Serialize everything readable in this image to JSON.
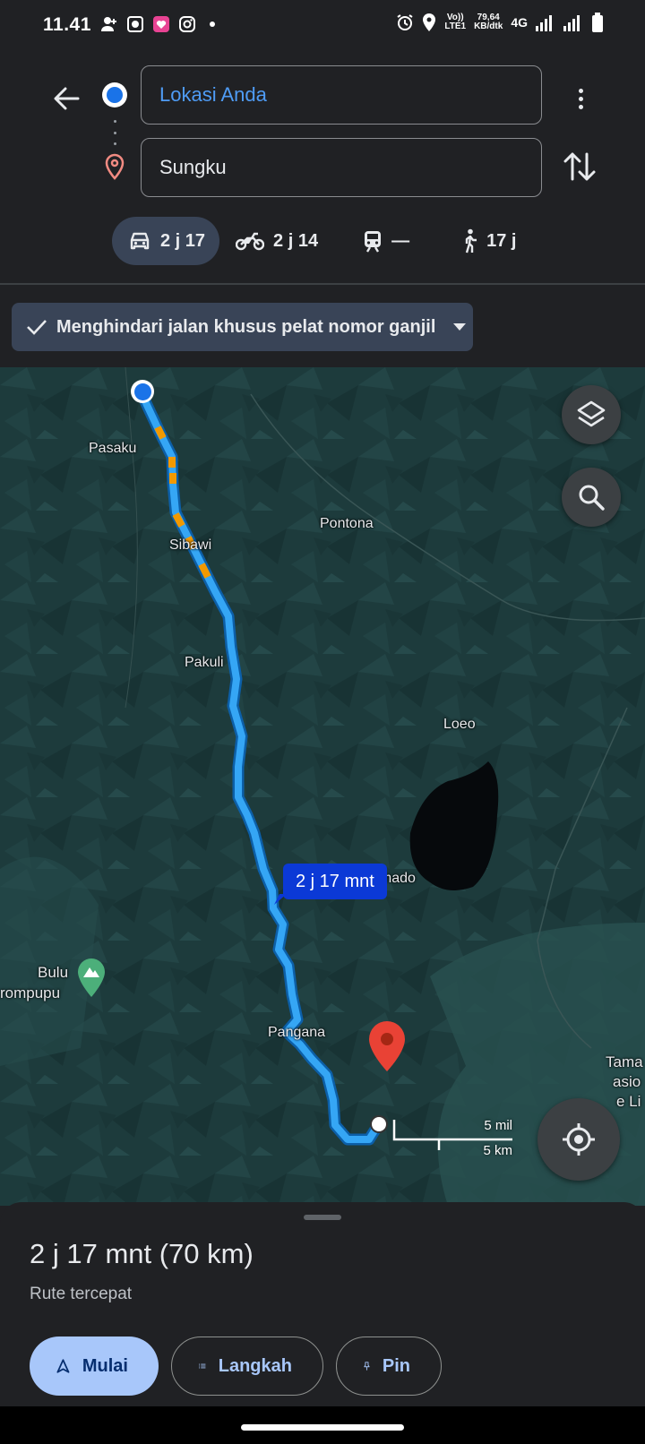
{
  "status_bar": {
    "time": "11.41",
    "network_speed_value": "79,64",
    "network_speed_unit": "KB/dtk",
    "volte_top": "Vo))",
    "volte_bottom": "LTE1",
    "network_type": "4G"
  },
  "directions": {
    "origin": "Lokasi Anda",
    "destination": "Sungku"
  },
  "travel_modes": [
    {
      "mode": "car",
      "label": "2 j 17",
      "active": true
    },
    {
      "mode": "motorcycle",
      "label": "2 j 14",
      "active": false
    },
    {
      "mode": "transit",
      "label": "—",
      "active": false
    },
    {
      "mode": "walking",
      "label": "17 j",
      "active": false
    }
  ],
  "filter_chip": {
    "label": "Menghindari jalan khusus pelat nomor ganjil"
  },
  "map": {
    "places": [
      "Pasaku",
      "Sibawi",
      "Pontona",
      "Pakuli",
      "Loeo",
      "Tomado",
      "Bulu",
      "rompupu",
      "Pangana",
      "Tama",
      "asio",
      "e Li"
    ],
    "eta_bubble": "2 j 17 mnt",
    "scale_miles": "5 mil",
    "scale_km": "5 km",
    "colors": {
      "route": "#35a6f5",
      "route_traffic": "#f29900",
      "water": "#06090c",
      "destination_pin": "#e94235"
    }
  },
  "sheet": {
    "route_summary": "2 j 17 mnt (70 km)",
    "route_type": "Rute tercepat",
    "actions": {
      "start": "Mulai",
      "steps": "Langkah",
      "pin": "Pin"
    }
  }
}
